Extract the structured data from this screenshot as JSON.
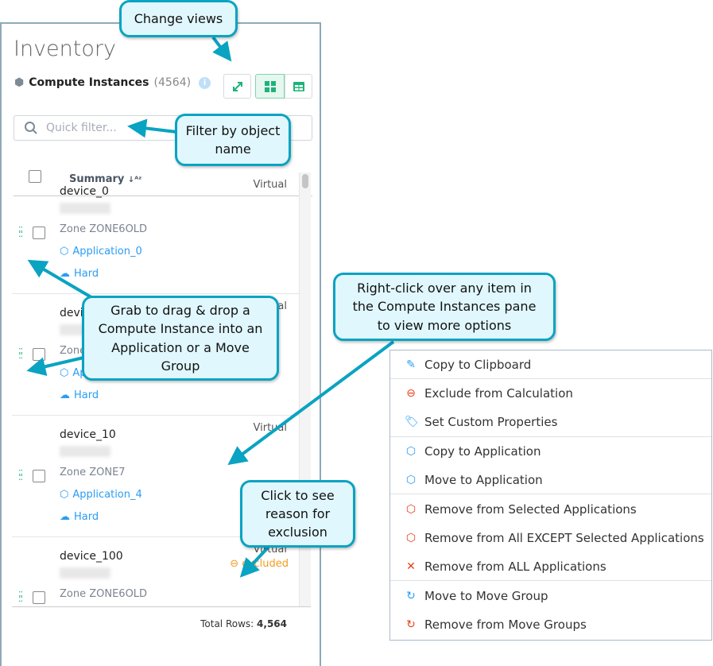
{
  "panel": {
    "title": "Inventory",
    "subtitle": "Compute Instances",
    "count": "(4564)",
    "info_icon": "info-icon",
    "view_buttons": [
      "expand-icon",
      "card-view-icon",
      "table-view-icon"
    ],
    "filter_placeholder": "Quick filter...",
    "column_header": "Summary",
    "rows": [
      {
        "name": "device_0",
        "type": "Virtual",
        "zone": "Zone ZONE6OLD",
        "application": "Application_0",
        "move_group": "Hard"
      },
      {
        "name": "device_1",
        "type": "Virtual",
        "zone": "Zone ZONE6OLD",
        "application": "Application_0",
        "move_group": "Hard"
      },
      {
        "name": "device_10",
        "type": "Virtual",
        "zone": "Zone ZONE7",
        "application": "Application_4",
        "move_group": "Hard"
      },
      {
        "name": "device_100",
        "type": "Virtual",
        "status": "excluded",
        "zone": "Zone ZONE6OLD"
      }
    ],
    "total_label": "Total Rows:",
    "total_value": "4,564"
  },
  "context_menu": {
    "items": [
      {
        "label": "Copy to Clipboard",
        "icon": "edit-icon"
      },
      {
        "label": "Exclude from Calculation",
        "icon": "minus-circle-icon"
      },
      {
        "label": "Set Custom Properties",
        "icon": "tags-icon"
      },
      {
        "label": "Copy to Application",
        "icon": "copy-to-app-icon"
      },
      {
        "label": "Move to Application",
        "icon": "move-to-app-icon"
      },
      {
        "label": "Remove from Selected Applications",
        "icon": "remove-app-icon"
      },
      {
        "label": "Remove from All EXCEPT Selected Applications",
        "icon": "remove-app-except-icon"
      },
      {
        "label": "Remove from ALL Applications",
        "icon": "x-icon"
      },
      {
        "label": "Move to Move Group",
        "icon": "move-group-icon"
      },
      {
        "label": "Remove from Move Groups",
        "icon": "remove-move-group-icon"
      }
    ]
  },
  "callouts": {
    "views": "Change views",
    "filter": "Filter by object name",
    "drag": "Grab to drag & drop a Compute Instance into an Application or a Move Group",
    "right_click": "Right-click over any item in the Compute Instances pane to view more options",
    "exclusion": "Click to see reason for exclusion"
  },
  "colors": {
    "accent_green": "#1db37a",
    "link_blue": "#2a9df4",
    "excluded_orange": "#f39c21",
    "remove_red": "#e8401c",
    "callout_border": "#0aa3c2",
    "callout_fill": "#e0f7fd"
  }
}
